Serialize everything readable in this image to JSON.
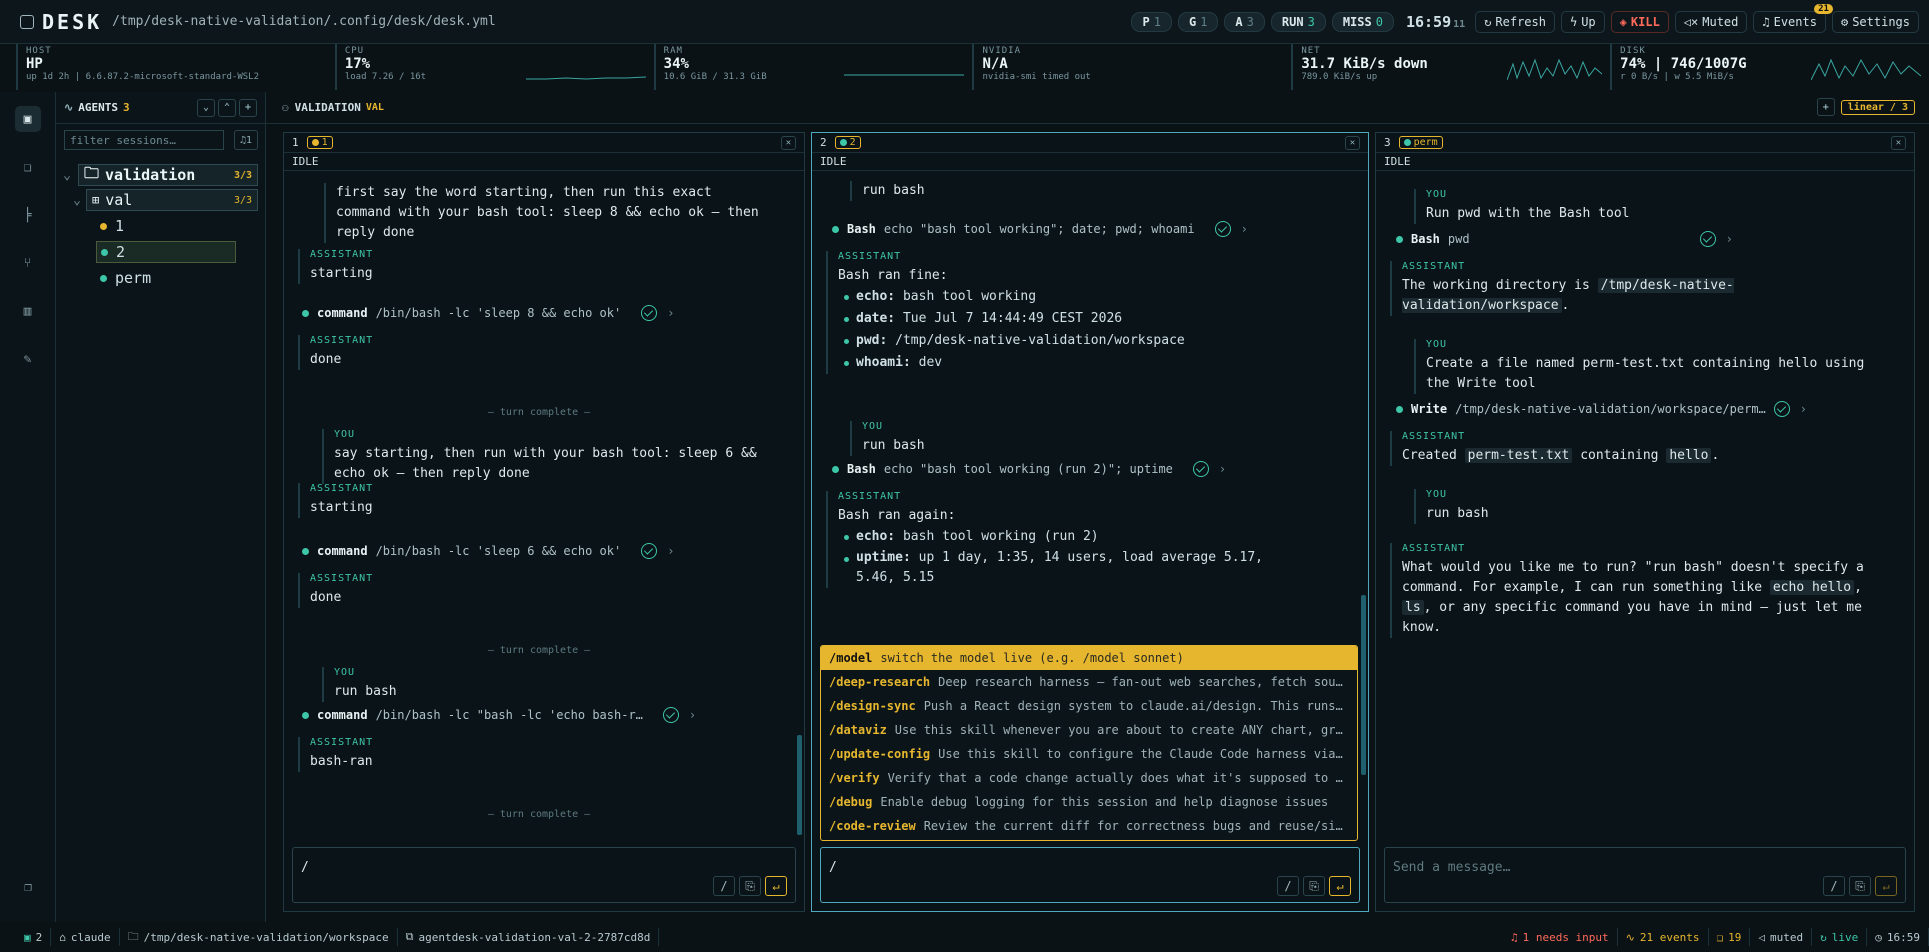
{
  "app": {
    "logo": "DESK",
    "config_path": "/tmp/desk-native-validation/.config/desk/desk.yml"
  },
  "top": {
    "pills": [
      {
        "k": "P",
        "n": "1"
      },
      {
        "k": "G",
        "n": "1"
      },
      {
        "k": "A",
        "n": "3"
      },
      {
        "k": "RUN",
        "n": "3"
      },
      {
        "k": "MISS",
        "n": "0"
      }
    ],
    "clock": "16:59",
    "clock_sec": "11",
    "refresh": "Refresh",
    "up": "Up",
    "kill": "KILL",
    "muted": "Muted",
    "events": "Events",
    "events_badge": "21",
    "settings": "Settings"
  },
  "stats": [
    {
      "k": "HOST",
      "v": "HP",
      "s": "up 1d 2h | 6.6.87.2-microsoft-standard-WSL2"
    },
    {
      "k": "CPU",
      "v": "17%",
      "s": "load 7.26 / 16t"
    },
    {
      "k": "RAM",
      "v": "34%",
      "s": "10.6 GiB / 31.3 GiB"
    },
    {
      "k": "NVIDIA",
      "v": "N/A",
      "s": "nvidia-smi timed out"
    },
    {
      "k": "NET",
      "v": "31.7 KiB/s down",
      "s": "789.0 KiB/s up"
    },
    {
      "k": "DISK",
      "v": "74% | 746/1007G",
      "s": "r 0 B/s | w 5.5 MiB/s"
    }
  ],
  "sidebar": {
    "title": "AGENTS",
    "count": "3",
    "filter_placeholder": "filter sessions…",
    "filter_badge": "1",
    "group": "validation",
    "group_count": "3/3",
    "sub": "val",
    "sub_count": "3/3",
    "items": [
      "1",
      "2",
      "perm"
    ]
  },
  "main": {
    "title": "VALIDATION",
    "tag": "VAL",
    "layout": "linear / 3"
  },
  "panes": [
    {
      "num": "1",
      "tab": "1",
      "state": "IDLE",
      "input": "/",
      "msgs": {
        "u1": "first say the word starting, then run this exact command with your bash tool: sleep 8 && echo ok — then reply done",
        "a1": "starting",
        "t1n": "command",
        "t1a": "/bin/bash -lc 'sleep 8 && echo ok'",
        "a2": "done",
        "tc": "— turn complete —",
        "u2": "say starting, then run with your bash tool: sleep 6 && echo ok — then reply done",
        "a3": "starting",
        "t2n": "command",
        "t2a": "/bin/bash -lc 'sleep 6 && echo ok'",
        "a4": "done",
        "u3": "run bash",
        "t3n": "command",
        "t3a": "/bin/bash -lc \"bash -lc 'echo bash-r…",
        "a5": "bash-ran"
      }
    },
    {
      "num": "2",
      "tab": "2",
      "state": "IDLE",
      "input": "/",
      "msgs": {
        "u1": "run bash",
        "t1n": "Bash",
        "t1a": "echo \"bash tool working\"; date; pwd; whoami",
        "a1": "Bash ran fine:",
        "l1": [
          [
            "echo:",
            "bash tool working"
          ],
          [
            "date:",
            "Tue Jul 7 14:44:49 CEST 2026"
          ],
          [
            "pwd:",
            "/tmp/desk-native-validation/workspace"
          ],
          [
            "whoami:",
            "dev"
          ]
        ],
        "u2": "run bash",
        "t2n": "Bash",
        "t2a": "echo \"bash tool working (run 2)\"; uptime",
        "a2": "Bash ran again:",
        "l2": [
          [
            "echo:",
            "bash tool working (run 2)"
          ],
          [
            "uptime:",
            "up 1 day, 1:35, 14 users, load average 5.17, 5.46, 5.15"
          ]
        ]
      },
      "menu": [
        {
          "c": "/model",
          "d": "switch the model live (e.g. /model sonnet)"
        },
        {
          "c": "/deep-research",
          "d": "Deep research harness — fan-out web searches, fetch sou…"
        },
        {
          "c": "/design-sync",
          "d": "Push a React design system to claude.ai/design. This runs…"
        },
        {
          "c": "/dataviz",
          "d": "Use this skill whenever you are about to create ANY chart, gr…"
        },
        {
          "c": "/update-config",
          "d": "Use this skill to configure the Claude Code harness via…"
        },
        {
          "c": "/verify",
          "d": "Verify that a code change actually does what it's supposed to …"
        },
        {
          "c": "/debug",
          "d": "Enable debug logging for this session and help diagnose issues"
        },
        {
          "c": "/code-review",
          "d": "Review the current diff for correctness bugs and reuse/si…"
        }
      ]
    },
    {
      "num": "3",
      "tab": "perm",
      "state": "IDLE",
      "input_placeholder": "Send a message…",
      "msgs": {
        "u1": "Run pwd with the Bash tool",
        "t1n": "Bash",
        "t1a": "pwd",
        "a1a": "The working directory is",
        "a1c": "/tmp/desk-native-validation/workspace",
        "u2": "Create a file named perm-test.txt containing hello using the Write tool",
        "t2n": "Write",
        "t2a": "/tmp/desk-native-validation/workspace/perm…",
        "a2a": "Created",
        "a2c": "perm-test.txt",
        "a2b": "containing",
        "a2d": "hello",
        "u3": "run bash",
        "a3a": "What would you like me to run? \"run bash\" doesn't specify a command. For example, I can run something like",
        "a3c1": "echo hello",
        "a3c2": "ls",
        "a3b": ", or any specific command you have in mind — just let me know."
      }
    }
  ],
  "labels": {
    "you": "YOU",
    "assistant": "ASSISTANT"
  },
  "status": {
    "sessions": "2",
    "agent": "claude",
    "cwd": "/tmp/desk-native-validation/workspace",
    "session": "agentdesk-validation-val-2-2787cd8d",
    "needs": "1 needs input",
    "events": "21 events",
    "msgs": "19",
    "muted": "muted",
    "live": "live",
    "time": "16:59"
  }
}
